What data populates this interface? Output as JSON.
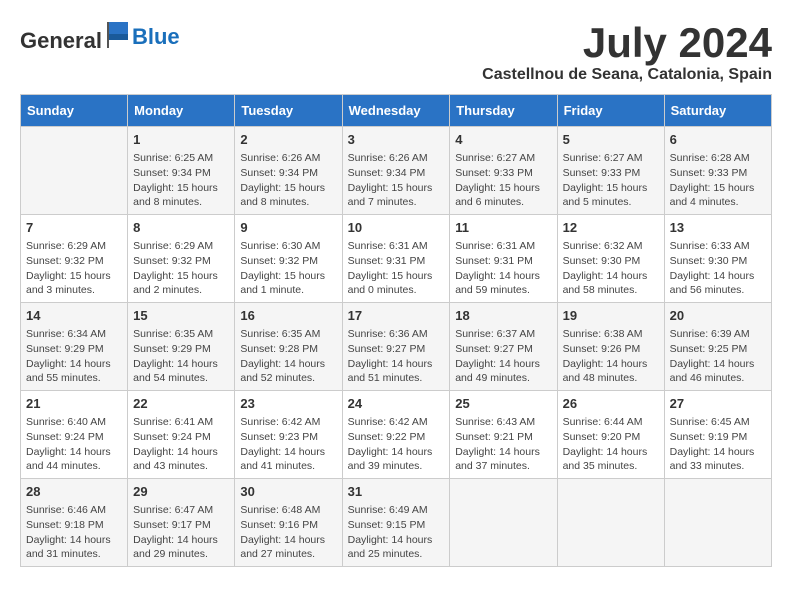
{
  "header": {
    "logo_general": "General",
    "logo_blue": "Blue",
    "month_year": "July 2024",
    "location": "Castellnou de Seana, Catalonia, Spain"
  },
  "days_of_week": [
    "Sunday",
    "Monday",
    "Tuesday",
    "Wednesday",
    "Thursday",
    "Friday",
    "Saturday"
  ],
  "weeks": [
    [
      {
        "day": "",
        "content": ""
      },
      {
        "day": "1",
        "content": "Sunrise: 6:25 AM\nSunset: 9:34 PM\nDaylight: 15 hours\nand 8 minutes."
      },
      {
        "day": "2",
        "content": "Sunrise: 6:26 AM\nSunset: 9:34 PM\nDaylight: 15 hours\nand 8 minutes."
      },
      {
        "day": "3",
        "content": "Sunrise: 6:26 AM\nSunset: 9:34 PM\nDaylight: 15 hours\nand 7 minutes."
      },
      {
        "day": "4",
        "content": "Sunrise: 6:27 AM\nSunset: 9:33 PM\nDaylight: 15 hours\nand 6 minutes."
      },
      {
        "day": "5",
        "content": "Sunrise: 6:27 AM\nSunset: 9:33 PM\nDaylight: 15 hours\nand 5 minutes."
      },
      {
        "day": "6",
        "content": "Sunrise: 6:28 AM\nSunset: 9:33 PM\nDaylight: 15 hours\nand 4 minutes."
      }
    ],
    [
      {
        "day": "7",
        "content": "Sunrise: 6:29 AM\nSunset: 9:32 PM\nDaylight: 15 hours\nand 3 minutes."
      },
      {
        "day": "8",
        "content": "Sunrise: 6:29 AM\nSunset: 9:32 PM\nDaylight: 15 hours\nand 2 minutes."
      },
      {
        "day": "9",
        "content": "Sunrise: 6:30 AM\nSunset: 9:32 PM\nDaylight: 15 hours\nand 1 minute."
      },
      {
        "day": "10",
        "content": "Sunrise: 6:31 AM\nSunset: 9:31 PM\nDaylight: 15 hours\nand 0 minutes."
      },
      {
        "day": "11",
        "content": "Sunrise: 6:31 AM\nSunset: 9:31 PM\nDaylight: 14 hours\nand 59 minutes."
      },
      {
        "day": "12",
        "content": "Sunrise: 6:32 AM\nSunset: 9:30 PM\nDaylight: 14 hours\nand 58 minutes."
      },
      {
        "day": "13",
        "content": "Sunrise: 6:33 AM\nSunset: 9:30 PM\nDaylight: 14 hours\nand 56 minutes."
      }
    ],
    [
      {
        "day": "14",
        "content": "Sunrise: 6:34 AM\nSunset: 9:29 PM\nDaylight: 14 hours\nand 55 minutes."
      },
      {
        "day": "15",
        "content": "Sunrise: 6:35 AM\nSunset: 9:29 PM\nDaylight: 14 hours\nand 54 minutes."
      },
      {
        "day": "16",
        "content": "Sunrise: 6:35 AM\nSunset: 9:28 PM\nDaylight: 14 hours\nand 52 minutes."
      },
      {
        "day": "17",
        "content": "Sunrise: 6:36 AM\nSunset: 9:27 PM\nDaylight: 14 hours\nand 51 minutes."
      },
      {
        "day": "18",
        "content": "Sunrise: 6:37 AM\nSunset: 9:27 PM\nDaylight: 14 hours\nand 49 minutes."
      },
      {
        "day": "19",
        "content": "Sunrise: 6:38 AM\nSunset: 9:26 PM\nDaylight: 14 hours\nand 48 minutes."
      },
      {
        "day": "20",
        "content": "Sunrise: 6:39 AM\nSunset: 9:25 PM\nDaylight: 14 hours\nand 46 minutes."
      }
    ],
    [
      {
        "day": "21",
        "content": "Sunrise: 6:40 AM\nSunset: 9:24 PM\nDaylight: 14 hours\nand 44 minutes."
      },
      {
        "day": "22",
        "content": "Sunrise: 6:41 AM\nSunset: 9:24 PM\nDaylight: 14 hours\nand 43 minutes."
      },
      {
        "day": "23",
        "content": "Sunrise: 6:42 AM\nSunset: 9:23 PM\nDaylight: 14 hours\nand 41 minutes."
      },
      {
        "day": "24",
        "content": "Sunrise: 6:42 AM\nSunset: 9:22 PM\nDaylight: 14 hours\nand 39 minutes."
      },
      {
        "day": "25",
        "content": "Sunrise: 6:43 AM\nSunset: 9:21 PM\nDaylight: 14 hours\nand 37 minutes."
      },
      {
        "day": "26",
        "content": "Sunrise: 6:44 AM\nSunset: 9:20 PM\nDaylight: 14 hours\nand 35 minutes."
      },
      {
        "day": "27",
        "content": "Sunrise: 6:45 AM\nSunset: 9:19 PM\nDaylight: 14 hours\nand 33 minutes."
      }
    ],
    [
      {
        "day": "28",
        "content": "Sunrise: 6:46 AM\nSunset: 9:18 PM\nDaylight: 14 hours\nand 31 minutes."
      },
      {
        "day": "29",
        "content": "Sunrise: 6:47 AM\nSunset: 9:17 PM\nDaylight: 14 hours\nand 29 minutes."
      },
      {
        "day": "30",
        "content": "Sunrise: 6:48 AM\nSunset: 9:16 PM\nDaylight: 14 hours\nand 27 minutes."
      },
      {
        "day": "31",
        "content": "Sunrise: 6:49 AM\nSunset: 9:15 PM\nDaylight: 14 hours\nand 25 minutes."
      },
      {
        "day": "",
        "content": ""
      },
      {
        "day": "",
        "content": ""
      },
      {
        "day": "",
        "content": ""
      }
    ]
  ]
}
